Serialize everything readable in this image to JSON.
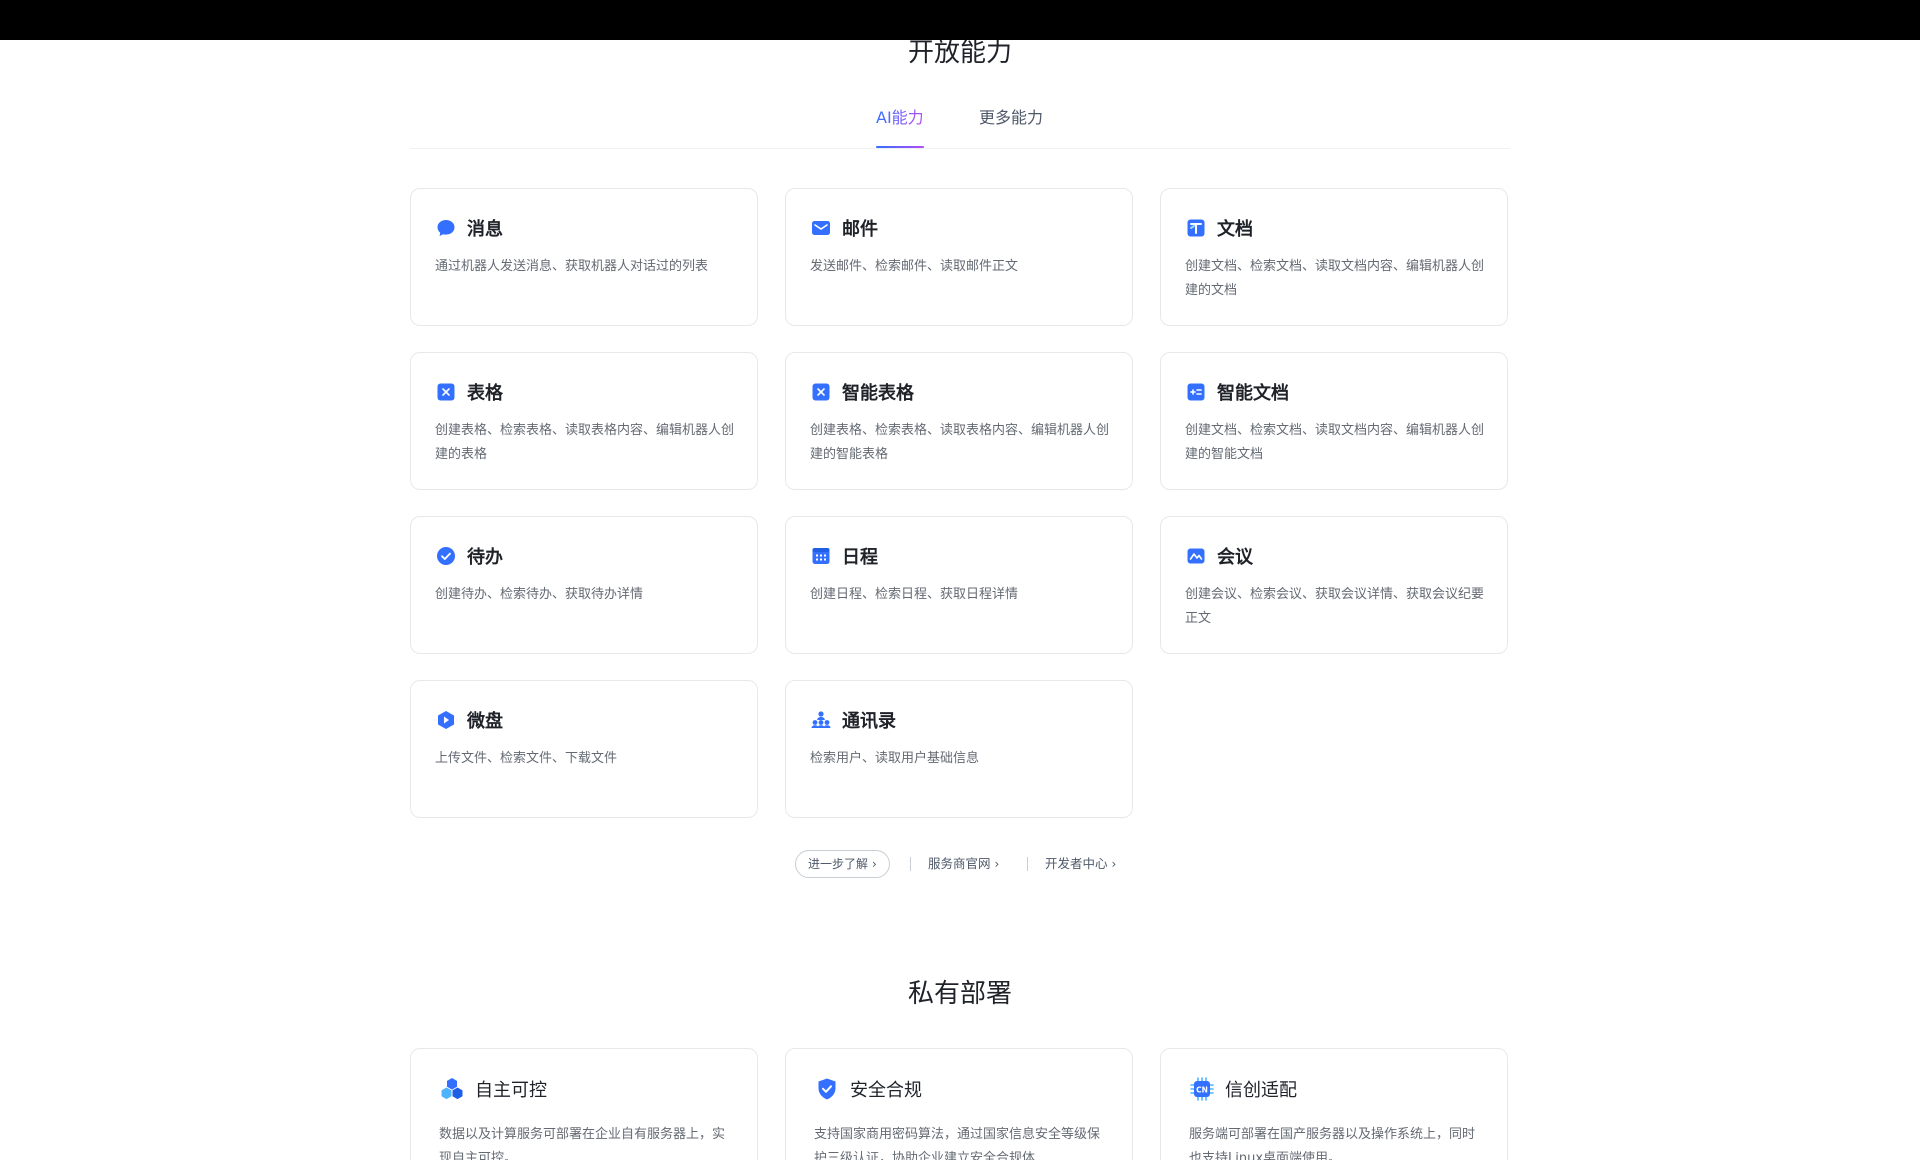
{
  "open_ability": {
    "title": "开放能力",
    "tabs": [
      {
        "label": "AI能力",
        "active": true
      },
      {
        "label": "更多能力",
        "active": false
      }
    ],
    "cards": [
      {
        "icon": "message-bubble-icon",
        "title": "消息",
        "desc": "通过机器人发送消息、获取机器人对话过的列表"
      },
      {
        "icon": "mail-icon",
        "title": "邮件",
        "desc": "发送邮件、检索邮件、读取邮件正文"
      },
      {
        "icon": "document-icon",
        "title": "文档",
        "desc": "创建文档、检索文档、读取文档内容、编辑机器人创建的文档"
      },
      {
        "icon": "sheet-icon",
        "title": "表格",
        "desc": "创建表格、检索表格、读取表格内容、编辑机器人创建的表格"
      },
      {
        "icon": "smart-sheet-icon",
        "title": "智能表格",
        "desc": "创建表格、检索表格、读取表格内容、编辑机器人创建的智能表格"
      },
      {
        "icon": "smart-doc-icon",
        "title": "智能文档",
        "desc": "创建文档、检索文档、读取文档内容、编辑机器人创建的智能文档"
      },
      {
        "icon": "todo-check-icon",
        "title": "待办",
        "desc": "创建待办、检索待办、获取待办详情"
      },
      {
        "icon": "calendar-icon",
        "title": "日程",
        "desc": "创建日程、检索日程、获取日程详情"
      },
      {
        "icon": "meeting-icon",
        "title": "会议",
        "desc": "创建会议、检索会议、获取会议详情、获取会议纪要正文"
      },
      {
        "icon": "drive-icon",
        "title": "微盘",
        "desc": "上传文件、检索文件、下载文件"
      },
      {
        "icon": "contacts-icon",
        "title": "通讯录",
        "desc": "检索用户、读取用户基础信息"
      }
    ],
    "links": {
      "learn_more": "进一步了解",
      "provider_site": "服务商官网",
      "developer_center": "开发者中心"
    }
  },
  "private_deploy": {
    "title": "私有部署",
    "cards": [
      {
        "icon": "hexagon-cluster-icon",
        "title": "自主可控",
        "desc": "数据以及计算服务可部署在企业自有服务器上，实现自主可控。"
      },
      {
        "icon": "shield-check-icon",
        "title": "安全合规",
        "desc": "支持国家商用密码算法，通过国家信息安全等级保护三级认证，协助企业建立安全合规体"
      },
      {
        "icon": "cn-chip-icon",
        "title": "信创适配",
        "desc": "服务端可部署在国产服务器以及操作系统上，同时也支持Linux桌面端使用。"
      }
    ]
  },
  "colors": {
    "accent": "#3370ff",
    "accent2": "#b44bf2",
    "text": "#1f2329",
    "muted": "#646a73"
  }
}
